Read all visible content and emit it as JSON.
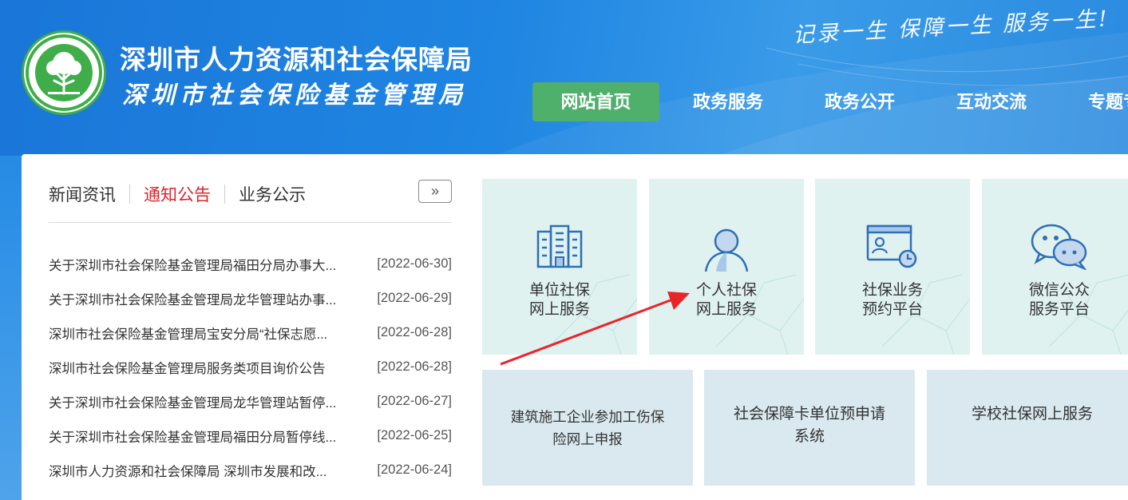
{
  "header": {
    "org_title": "深圳市人力资源和社会保障局",
    "org_subtitle": "深圳市社会保险基金管理局",
    "slogan": "记录一生 保障一生 服务一生!",
    "logo_icon": "tree-emblem-icon"
  },
  "nav": {
    "items": [
      {
        "label": "网站首页",
        "active": true
      },
      {
        "label": "政务服务"
      },
      {
        "label": "政务公开"
      },
      {
        "label": "互动交流"
      },
      {
        "label": "专题专"
      }
    ]
  },
  "news": {
    "tabs": [
      {
        "label": "新闻资讯"
      },
      {
        "label": "通知公告",
        "active": true
      },
      {
        "label": "业务公示"
      }
    ],
    "more_label": "»",
    "items": [
      {
        "title": "关于深圳市社会保险基金管理局福田分局办事大...",
        "date": "[2022-06-30]"
      },
      {
        "title": "关于深圳市社会保险基金管理局龙华管理站办事...",
        "date": "[2022-06-29]"
      },
      {
        "title": "深圳市社会保险基金管理局宝安分局“社保志愿...",
        "date": "[2022-06-28]"
      },
      {
        "title": "深圳市社会保险基金管理局服务类项目询价公告",
        "date": "[2022-06-28]"
      },
      {
        "title": "关于深圳市社会保险基金管理局龙华管理站暂停...",
        "date": "[2022-06-27]"
      },
      {
        "title": "关于深圳市社会保险基金管理局福田分局暂停线...",
        "date": "[2022-06-25]"
      },
      {
        "title": "深圳市人力资源和社会保障局 深圳市发展和改...",
        "date": "[2022-06-24]"
      }
    ]
  },
  "services": {
    "top": [
      {
        "line1": "单位社保",
        "line2": "网上服务",
        "icon": "building-icon"
      },
      {
        "line1": "个人社保",
        "line2": "网上服务",
        "icon": "person-icon"
      },
      {
        "line1": "社保业务",
        "line2": "预约平台",
        "icon": "appointment-card-icon"
      },
      {
        "line1": "微信公众",
        "line2": "服务平台",
        "icon": "wechat-icon"
      }
    ],
    "bottom": [
      {
        "label": "建筑施工企业参加工伤保险网上申报"
      },
      {
        "label": "社会保障卡单位预申请系统"
      },
      {
        "label": "学校社保网上服务"
      }
    ]
  },
  "colors": {
    "header_blue": "#1f86e2",
    "nav_active_green": "#4fb06b",
    "active_tab_red": "#d9262c",
    "tile_mint": "#e0f2f0",
    "tile_blue": "#d9e9ef",
    "icon_blue": "#2e6fb6",
    "arrow_red": "#e8262a"
  }
}
